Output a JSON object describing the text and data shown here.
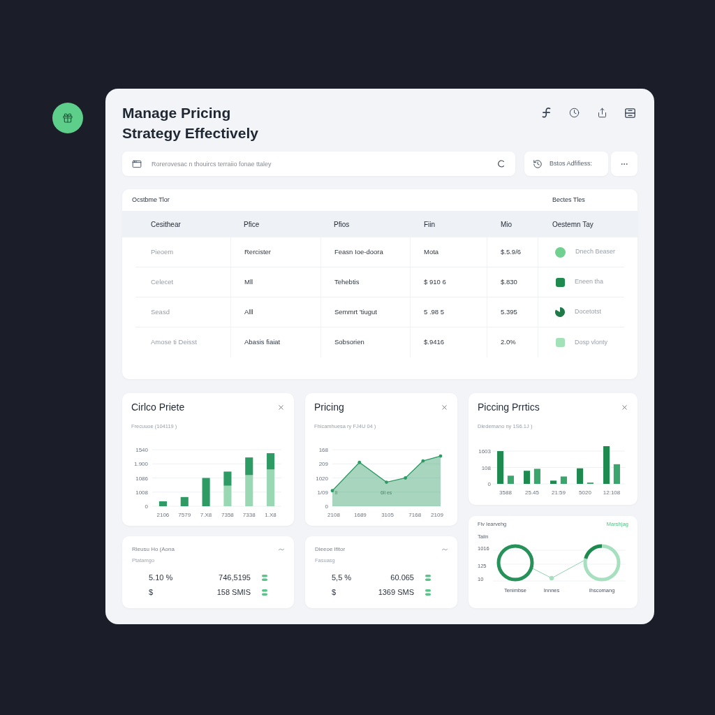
{
  "header": {
    "title": "Manage Pricing Strategy Effectively"
  },
  "search": {
    "placeholder": "Rorerovesac n thouircs terraiio fonae ttaley"
  },
  "filter_button": {
    "label": "Bstos Adfifiess:"
  },
  "table": {
    "title": "Ocstbme Tlor",
    "aside": "Bectes Tles",
    "columns": [
      "Cesithear",
      "Pfice",
      "Pfios",
      "Fiin",
      "Mio",
      "Oestemn Tay"
    ],
    "rows": [
      {
        "cells": [
          "Pieoem",
          "Rercister",
          "Feasn Ioe-doora",
          "Mota",
          "$.5.9/6"
        ],
        "status": {
          "kind": "dot",
          "color": "#6fd08f",
          "label": "Dnech Beaser"
        }
      },
      {
        "cells": [
          "Celecet",
          "Mll",
          "Tehebtis",
          "$ 910 6",
          "$.830"
        ],
        "status": {
          "kind": "tile",
          "color": "#1e8a4e",
          "label": "Eneen tha"
        }
      },
      {
        "cells": [
          "Seasd",
          "Alll",
          "Semmrt 'tiugut",
          "5 .98 5",
          "5.395"
        ],
        "status": {
          "kind": "pie",
          "color": "#1f7a48",
          "label": "Docetotst"
        }
      },
      {
        "cells": [
          "Amose ti Deisst",
          "Abasis fiaiat",
          "Sobsorien",
          "$.9416",
          "2.0%"
        ],
        "status": {
          "kind": "tile",
          "color": "#a3e2b9",
          "label": "Dosp vlonty"
        }
      }
    ]
  },
  "charts": [
    {
      "kind": "stacked",
      "title": "Cirlco Priete",
      "subtitle": "Frecuuoe (104119 )",
      "y_labels": [
        "1540",
        "1.900",
        "1086",
        "1008",
        "0"
      ],
      "x_labels": [
        "2106",
        "7579",
        "7.X8",
        "7358",
        "7338",
        "1.X8"
      ]
    },
    {
      "kind": "area",
      "title": "Pricing",
      "subtitle": "Fhicamhuesa ry FJ4U 04 )",
      "y_labels": [
        "168",
        "209",
        "1020",
        "1/09",
        "0"
      ],
      "x_labels": [
        "2108",
        "1689",
        "3105",
        "7168",
        "2109"
      ],
      "annotations": [
        "ll",
        "6ll es"
      ]
    },
    {
      "kind": "grouped",
      "title": "Piccing Prrtics",
      "subtitle": "Dledemano ny 1S6.1J )",
      "y_labels": [
        "1603",
        "108",
        "0"
      ],
      "x_labels": [
        "3588",
        "25.45",
        "21:59",
        "5020",
        "12:108"
      ]
    }
  ],
  "rings_card": {
    "title": "Fiv Iearvehg",
    "link": "Marsh|ag",
    "axis_title": "Taiin",
    "y_labels": [
      "1016",
      "125",
      "10"
    ],
    "labels": [
      "Tenimbse",
      "Innnes",
      "Ihscomang"
    ]
  },
  "summaries": [
    {
      "title": "Rleusu Ho (Aona",
      "subtitle": "Ptatamgo",
      "rows": [
        {
          "value": "5.10 %",
          "amount": "746,5195"
        },
        {
          "value": "$",
          "amount": "158 SMIS"
        }
      ]
    },
    {
      "title": "Dieeoe Ifitor",
      "subtitle": "Fasuasg",
      "rows": [
        {
          "value": "5,5 %",
          "amount": "60.065"
        },
        {
          "value": "$",
          "amount": "1369 SMS"
        }
      ]
    }
  ]
}
